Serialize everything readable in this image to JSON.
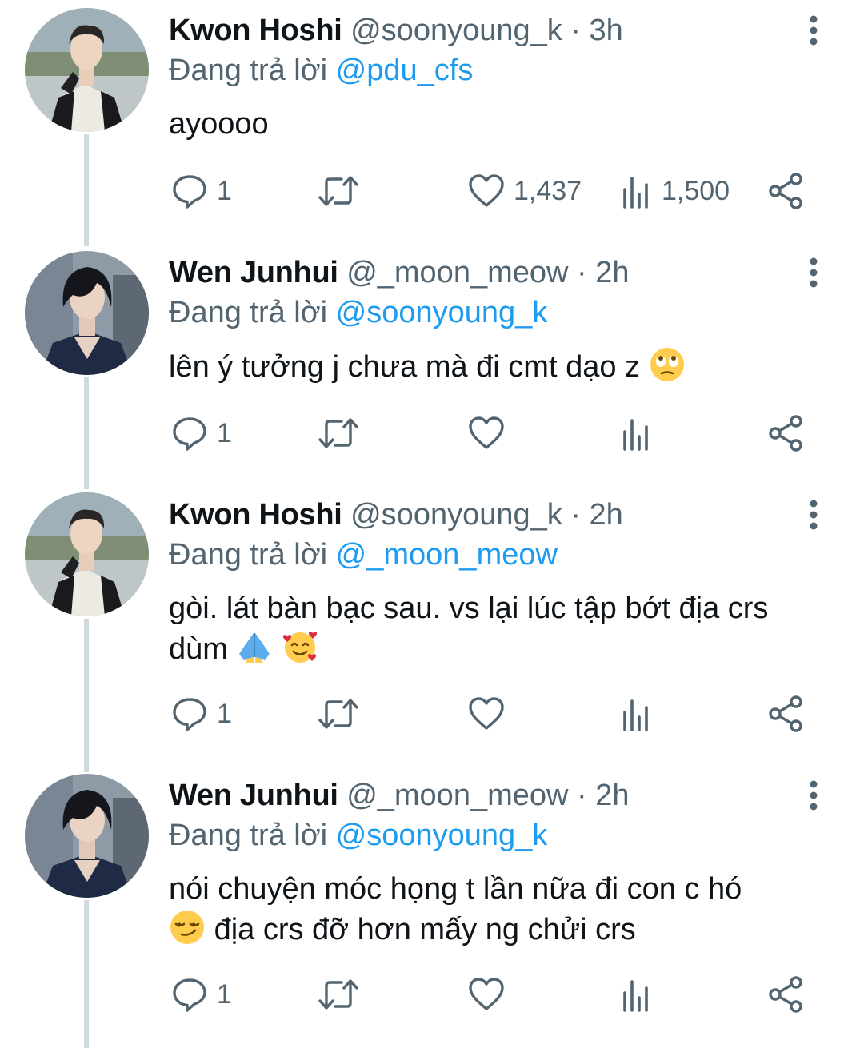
{
  "tweets": [
    {
      "author": "Kwon Hoshi",
      "handle": "@soonyoung_k",
      "separator": "·",
      "time": "3h",
      "reply_prefix": "Đang trả lời",
      "reply_to": "@pdu_cfs",
      "text": "ayoooo",
      "replies": "1",
      "likes": "1,437",
      "views": "1,500"
    },
    {
      "author": "Wen Junhui",
      "handle": "@_moon_meow",
      "separator": "·",
      "time": "2h",
      "reply_prefix": "Đang trả lời",
      "reply_to": "@soonyoung_k",
      "text": "lên ý tưởng j chưa mà đi cmt dạo z",
      "emoji": [
        "face-with-rolling-eyes"
      ],
      "replies": "1"
    },
    {
      "author": "Kwon Hoshi",
      "handle": "@soonyoung_k",
      "separator": "·",
      "time": "2h",
      "reply_prefix": "Đang trả lời",
      "reply_to": "@_moon_meow",
      "text_line1": "gòi. lát bàn bạc sau. vs lại lúc tập bớt địa crs",
      "text_line2": "dùm",
      "emoji": [
        "folded-hands",
        "smiling-face-with-hearts"
      ],
      "replies": "1"
    },
    {
      "author": "Wen Junhui",
      "handle": "@_moon_meow",
      "separator": "·",
      "time": "2h",
      "reply_prefix": "Đang trả lời",
      "reply_to": "@soonyoung_k",
      "text_line1": "nói chuyện móc họng t lần nữa đi con c hó",
      "text_line2": "địa crs đỡ hơn mấy ng chửi crs",
      "emoji": [
        "smirking-face"
      ],
      "replies": "1"
    }
  ],
  "icons": {
    "reply": "speech-bubble-icon",
    "retweet": "retweet-arrows-icon",
    "like": "heart-outline-icon",
    "views": "bar-chart-icon",
    "share": "share-icon",
    "more": "vertical-ellipsis-icon"
  },
  "colors": {
    "text": "#0f1419",
    "secondary": "#536471",
    "link": "#1d9bf0",
    "thread_line": "#cfd9de",
    "background": "#ffffff"
  }
}
